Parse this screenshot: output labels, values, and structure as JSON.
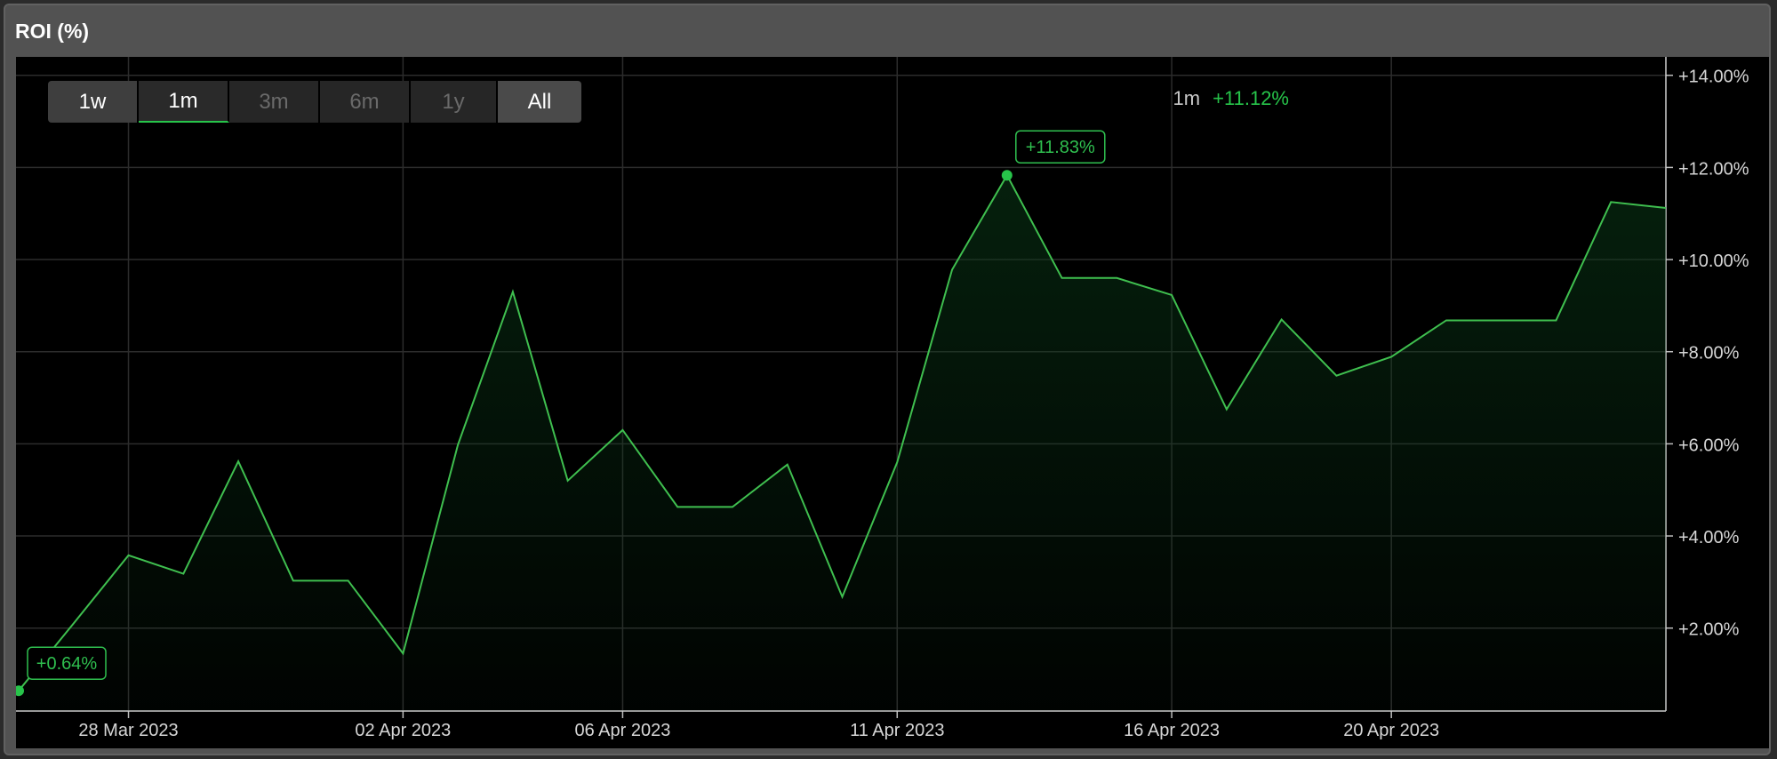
{
  "panel": {
    "title": "ROI (%)"
  },
  "ranges": [
    {
      "label": "1w",
      "state": "normal"
    },
    {
      "label": "1m",
      "state": "active"
    },
    {
      "label": "3m",
      "state": "disabled"
    },
    {
      "label": "6m",
      "state": "disabled"
    },
    {
      "label": "1y",
      "state": "disabled"
    },
    {
      "label": "All",
      "state": "all"
    }
  ],
  "summary": {
    "range_label": "1m",
    "value_label": "+11.12%"
  },
  "colors": {
    "line": "#3fbf4f",
    "marker": "#27c44a",
    "annotation": "#2fbf4f",
    "grid": "#2c2c2c",
    "axis_text": "#d6d6d6"
  },
  "chart_data": {
    "type": "area",
    "title": "ROI (%)",
    "xlabel": "",
    "ylabel": "",
    "x": [
      "2023-03-26",
      "2023-03-27",
      "2023-03-28",
      "2023-03-29",
      "2023-03-30",
      "2023-03-31",
      "2023-04-01",
      "2023-04-02",
      "2023-04-03",
      "2023-04-04",
      "2023-04-05",
      "2023-04-06",
      "2023-04-07",
      "2023-04-08",
      "2023-04-09",
      "2023-04-10",
      "2023-04-11",
      "2023-04-12",
      "2023-04-13",
      "2023-04-14",
      "2023-04-15",
      "2023-04-16",
      "2023-04-17",
      "2023-04-18",
      "2023-04-19",
      "2023-04-20",
      "2023-04-21",
      "2023-04-22",
      "2023-04-23",
      "2023-04-24",
      "2023-04-25",
      "2023-04-26"
    ],
    "series": [
      {
        "values": [
          0.64,
          2.1,
          3.58,
          3.18,
          5.62,
          3.03,
          3.03,
          1.45,
          5.98,
          9.3,
          5.2,
          6.3,
          4.63,
          4.63,
          5.55,
          2.68,
          5.6,
          9.78,
          11.83,
          9.6,
          9.6,
          9.23,
          6.75,
          8.7,
          7.48,
          7.89,
          8.68,
          8.68,
          8.68,
          11.25,
          11.12
        ]
      }
    ],
    "x_ticks": [
      "28 Mar 2023",
      "02 Apr 2023",
      "06 Apr 2023",
      "11 Apr 2023",
      "16 Apr 2023",
      "20 Apr 2023"
    ],
    "y_ticks": [
      "+2.00%",
      "+4.00%",
      "+6.00%",
      "+8.00%",
      "+10.00%",
      "+12.00%",
      "+14.00%"
    ],
    "ylim": [
      0.2,
      14.4
    ],
    "annotations": [
      {
        "label": "+0.64%",
        "point_index": 0
      },
      {
        "label": "+11.83%",
        "point_index": 18
      }
    ],
    "grid": true,
    "legend": "none"
  }
}
